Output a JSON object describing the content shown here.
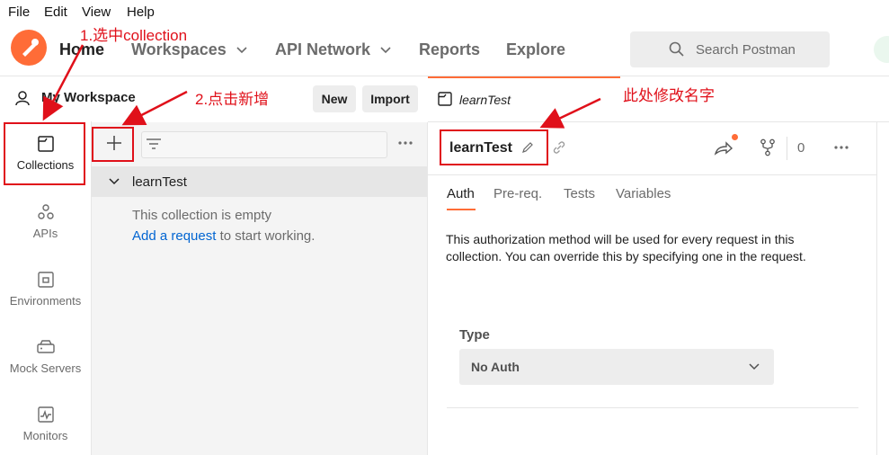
{
  "menu": [
    "File",
    "Edit",
    "View",
    "Help"
  ],
  "nav": {
    "home": "Home",
    "workspaces": "Workspaces",
    "api_network": "API Network",
    "reports": "Reports",
    "explore": "Explore"
  },
  "search": {
    "placeholder": "Search Postman"
  },
  "workspace": {
    "title": "My Workspace",
    "new_label": "New",
    "import_label": "Import"
  },
  "rail": [
    {
      "label": "Collections",
      "icon": "collection-icon"
    },
    {
      "label": "APIs",
      "icon": "apis-icon"
    },
    {
      "label": "Environments",
      "icon": "environment-icon"
    },
    {
      "label": "Mock Servers",
      "icon": "mock-server-icon"
    },
    {
      "label": "Monitors",
      "icon": "monitor-icon"
    }
  ],
  "collection": {
    "name": "learnTest",
    "empty_text": "This collection is empty",
    "add_link": "Add a request",
    "add_suffix": " to start working."
  },
  "tab": {
    "label": "learnTest"
  },
  "detail": {
    "title": "learnTest",
    "fork_count": "0",
    "tabs": [
      "Auth",
      "Pre-req.",
      "Tests",
      "Variables"
    ],
    "auth_desc": "This authorization method will be used for every request in this collection. You can override this by specifying one in the request.",
    "type_label": "Type",
    "type_value": "No Auth"
  },
  "annotations": {
    "a1": "1.选中collection",
    "a2": "2.点击新增",
    "a3": "此处修改名字"
  },
  "colors": {
    "accent": "#ff6c37",
    "annotation": "#e0101a",
    "link": "#0265d2"
  }
}
